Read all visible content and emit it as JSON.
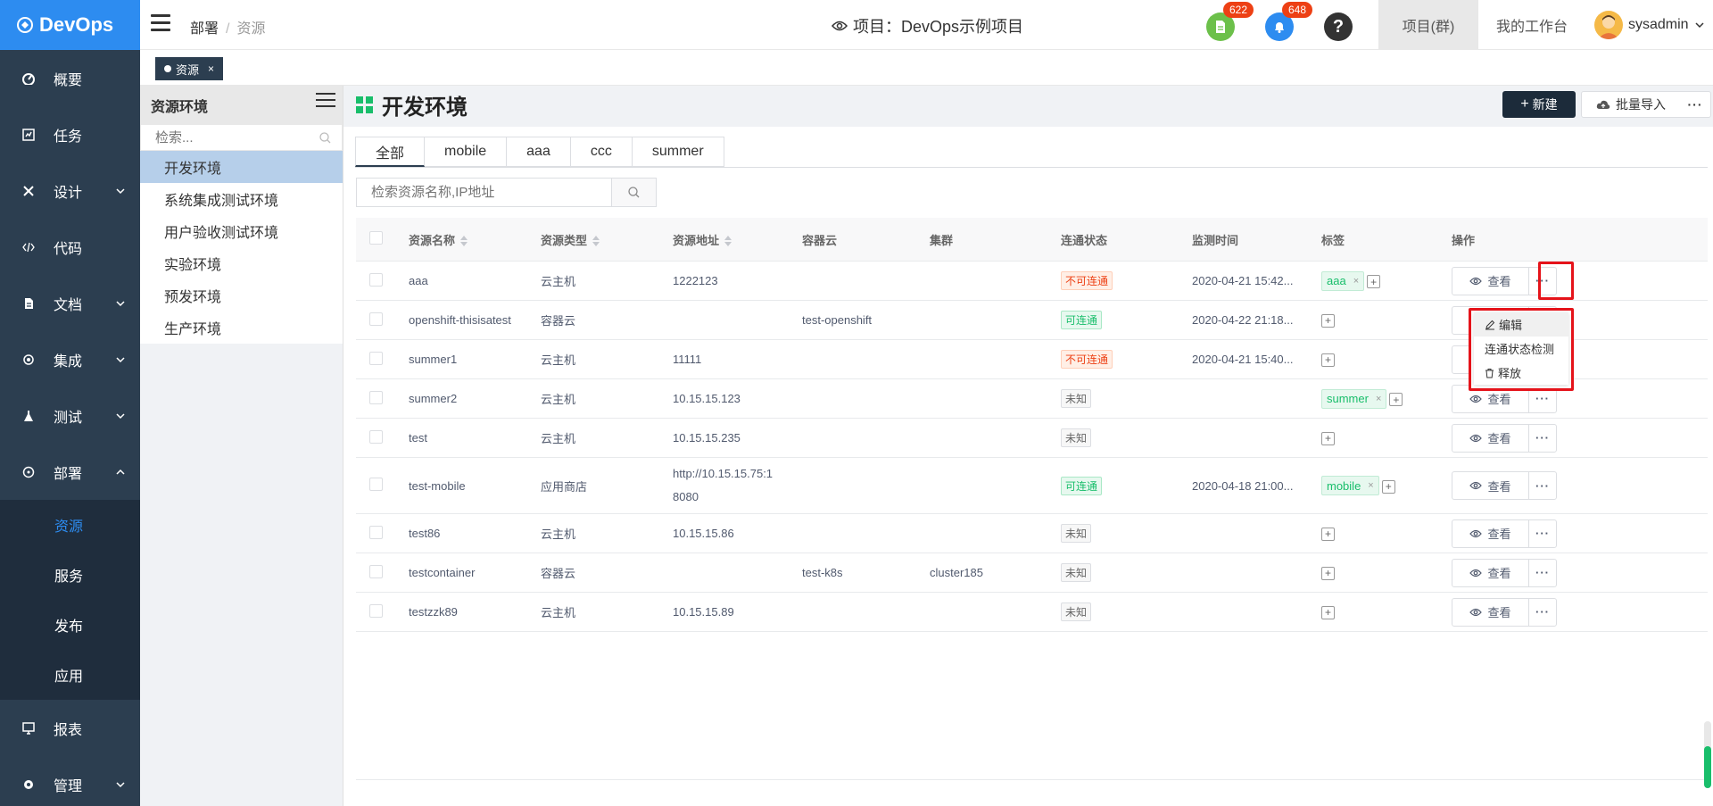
{
  "app": {
    "name": "DevOps"
  },
  "sidebar": {
    "items": [
      {
        "label": "概要",
        "icon": "dashboard-icon"
      },
      {
        "label": "任务",
        "icon": "task-icon"
      },
      {
        "label": "设计",
        "icon": "design-icon"
      },
      {
        "label": "代码",
        "icon": "code-icon"
      },
      {
        "label": "文档",
        "icon": "document-icon"
      },
      {
        "label": "集成",
        "icon": "integration-icon"
      },
      {
        "label": "测试",
        "icon": "test-flask-icon"
      },
      {
        "label": "部署",
        "icon": "deploy-icon"
      },
      {
        "label": "报表",
        "icon": "report-icon"
      },
      {
        "label": "管理",
        "icon": "settings-icon"
      }
    ],
    "deploy_sub": [
      "资源",
      "服务",
      "发布",
      "应用"
    ]
  },
  "header": {
    "breadcrumb": [
      "部署",
      "资源"
    ],
    "project": "项目：DevOps示例项目",
    "badge_doc": "622",
    "badge_bell": "648",
    "tab_project": "项目(群)",
    "tab_workspace": "我的工作台",
    "user": "sysadmin"
  },
  "tagbar": {
    "chip": "资源",
    "close": "×"
  },
  "leftpanel": {
    "title": "资源环境",
    "search_placeholder": "检索...",
    "items": [
      "开发环境",
      "系统集成测试环境",
      "用户验收测试环境",
      "实验环境",
      "预发环境",
      "生产环境"
    ]
  },
  "main": {
    "title": "开发环境",
    "new_label": "新建",
    "import_label": "批量导入",
    "more": "···",
    "tabs": [
      "全部",
      "mobile",
      "aaa",
      "ccc",
      "summer"
    ],
    "search_placeholder": "检索资源名称,IP地址",
    "columns": [
      "资源名称",
      "资源类型",
      "资源地址",
      "容器云",
      "集群",
      "连通状态",
      "监测时间",
      "标签",
      "操作"
    ],
    "view_label": "查看",
    "rows": [
      {
        "name": "aaa",
        "type": "云主机",
        "addr": "1222123",
        "cloud": "",
        "cluster": "",
        "status": "不可连通",
        "time": "2020-04-21 15:42...",
        "tag": "aaa"
      },
      {
        "name": "openshift-thisisatest",
        "type": "容器云",
        "addr": "",
        "cloud": "test-openshift",
        "cluster": "",
        "status": "可连通",
        "time": "2020-04-22 21:18...",
        "tag": ""
      },
      {
        "name": "summer1",
        "type": "云主机",
        "addr": "11111",
        "cloud": "",
        "cluster": "",
        "status": "不可连通",
        "time": "2020-04-21 15:40...",
        "tag": ""
      },
      {
        "name": "summer2",
        "type": "云主机",
        "addr": "10.15.15.123",
        "cloud": "",
        "cluster": "",
        "status": "未知",
        "time": "",
        "tag": "summer"
      },
      {
        "name": "test",
        "type": "云主机",
        "addr": "10.15.15.235",
        "cloud": "",
        "cluster": "",
        "status": "未知",
        "time": "",
        "tag": ""
      },
      {
        "name": "test-mobile",
        "type": "应用商店",
        "addr": "http://10.15.15.75:1",
        "addr2": "8080",
        "cloud": "",
        "cluster": "",
        "status": "可连通",
        "time": "2020-04-18 21:00...",
        "tag": "mobile"
      },
      {
        "name": "test86",
        "type": "云主机",
        "addr": "10.15.15.86",
        "cloud": "",
        "cluster": "",
        "status": "未知",
        "time": "",
        "tag": ""
      },
      {
        "name": "testcontainer",
        "type": "容器云",
        "addr": "",
        "cloud": "test-k8s",
        "cluster": "cluster185",
        "status": "未知",
        "time": "",
        "tag": ""
      },
      {
        "name": "testzzk89",
        "type": "云主机",
        "addr": "10.15.15.89",
        "cloud": "",
        "cluster": "",
        "status": "未知",
        "time": "",
        "tag": ""
      }
    ],
    "dropdown": [
      "编辑",
      "连通状态检测",
      "释放"
    ]
  },
  "colors": {
    "accent": "#2d8cf0",
    "sidebar": "#2c3e50",
    "danger": "#ed4014",
    "success": "#19be6b",
    "highlight": "#e5131a"
  }
}
